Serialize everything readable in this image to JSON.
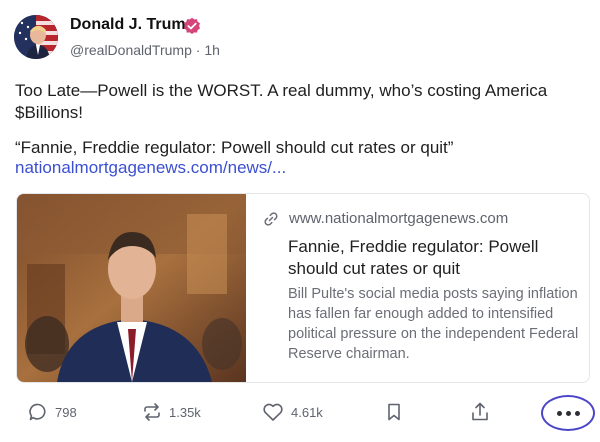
{
  "author": {
    "name": "Donald J. Trump",
    "handle": "@realDonaldTrump",
    "separator": "·",
    "time": "1h"
  },
  "post": {
    "text": "Too Late—Powell is the WORST. A real dummy, who’s costing America $Billions!",
    "quote": "“Fannie, Freddie regulator: Powell should cut rates or quit”",
    "link": "nationalmortgagenews.com/news/..."
  },
  "card": {
    "domain": "www.nationalmortgagenews.com",
    "title": "Fannie, Freddie regulator: Powell should cut rates or quit",
    "description": "Bill Pulte's social media posts saying inflation has fallen far enough added to intensified political pressure on the independent Federal Reserve chairman."
  },
  "actions": {
    "replies": "798",
    "reposts": "1.35k",
    "likes": "4.61k"
  },
  "colors": {
    "link": "#3b4fd1",
    "verified": "#d6457a",
    "more_ring": "#4b45c7"
  },
  "icons": [
    "reply-icon",
    "repost-icon",
    "like-icon",
    "bookmark-icon",
    "share-icon",
    "more-icon",
    "link-icon",
    "verified-icon"
  ]
}
